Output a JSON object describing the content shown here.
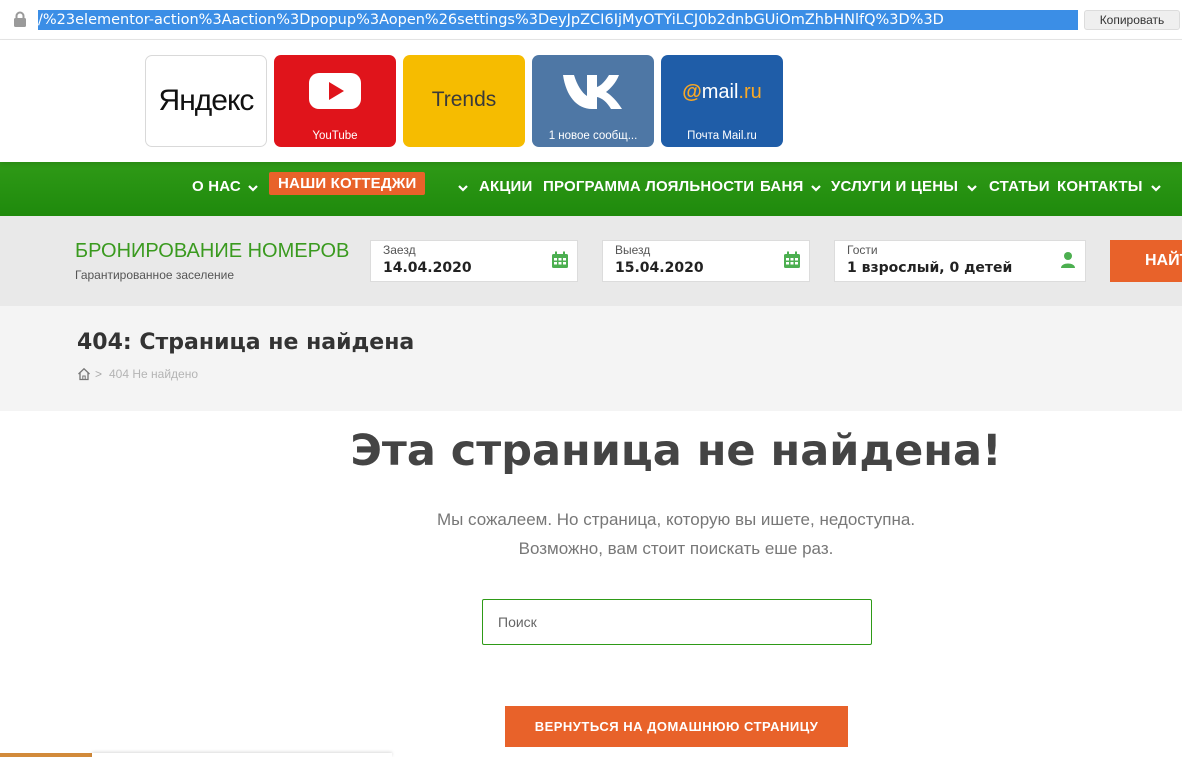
{
  "address_bar": {
    "url": "/%23elementor-action%3Aaction%3Dpopup%3Aopen%26settings%3DeyJpZCI6IjMyOTYiLCJ0b2dnbGUiOmZhbHNlfQ%3D%3D",
    "copy_label": "Копировать"
  },
  "speed_dial": [
    {
      "logo": "Яндекс",
      "caption": ""
    },
    {
      "logo": "youtube-play-icon",
      "caption": "YouTube"
    },
    {
      "logo": "Trends",
      "caption": ""
    },
    {
      "logo": "vk-icon",
      "caption": "1 новое сообщ..."
    },
    {
      "logo": "@mail.ru",
      "caption": "Почта Mail.ru"
    }
  ],
  "nav": {
    "items": [
      {
        "label": "О НАС",
        "dropdown": true
      },
      {
        "label": "НАШИ КОТТЕДЖИ",
        "dropdown": true,
        "active": true
      },
      {
        "label": "АКЦИИ",
        "dropdown": false
      },
      {
        "label": "ПРОГРАММА ЛОЯЛЬНОСТИ",
        "dropdown": false
      },
      {
        "label": "БАНЯ",
        "dropdown": true
      },
      {
        "label": "УСЛУГИ И ЦЕНЫ",
        "dropdown": true
      },
      {
        "label": "СТАТЬИ",
        "dropdown": false
      },
      {
        "label": "КОНТАКТЫ",
        "dropdown": true
      }
    ]
  },
  "booking": {
    "title": "БРОНИРОВАНИЕ НОМЕРОВ",
    "subtitle": "Гарантированное заселение",
    "checkin_label": "Заезд",
    "checkin_value": "14.04.2020",
    "checkout_label": "Выезд",
    "checkout_value": "15.04.2020",
    "guests_label": "Гости",
    "guests_value": "1 взрослый, 0 детей",
    "find_label": "НАЙТИ"
  },
  "page": {
    "title": "404: Страница не найдена",
    "breadcrumb_sep": ">",
    "breadcrumb_current": "404 Не найдено"
  },
  "main": {
    "headline": "Эта страница не найдена!",
    "message_line1": "Мы сожалеем. Но страница, которую вы ишете, недоступна.",
    "message_line2": "Возможно, вам стоит поискать еше раз.",
    "search_placeholder": "Поиск",
    "home_button": "ВЕРНУТЬСЯ НА ДОМАШНЮЮ СТРАНИЦУ"
  },
  "colors": {
    "nav_green": "#2f9a17",
    "accent_orange": "#e8622a",
    "booking_title_green": "#3a9a1f"
  }
}
